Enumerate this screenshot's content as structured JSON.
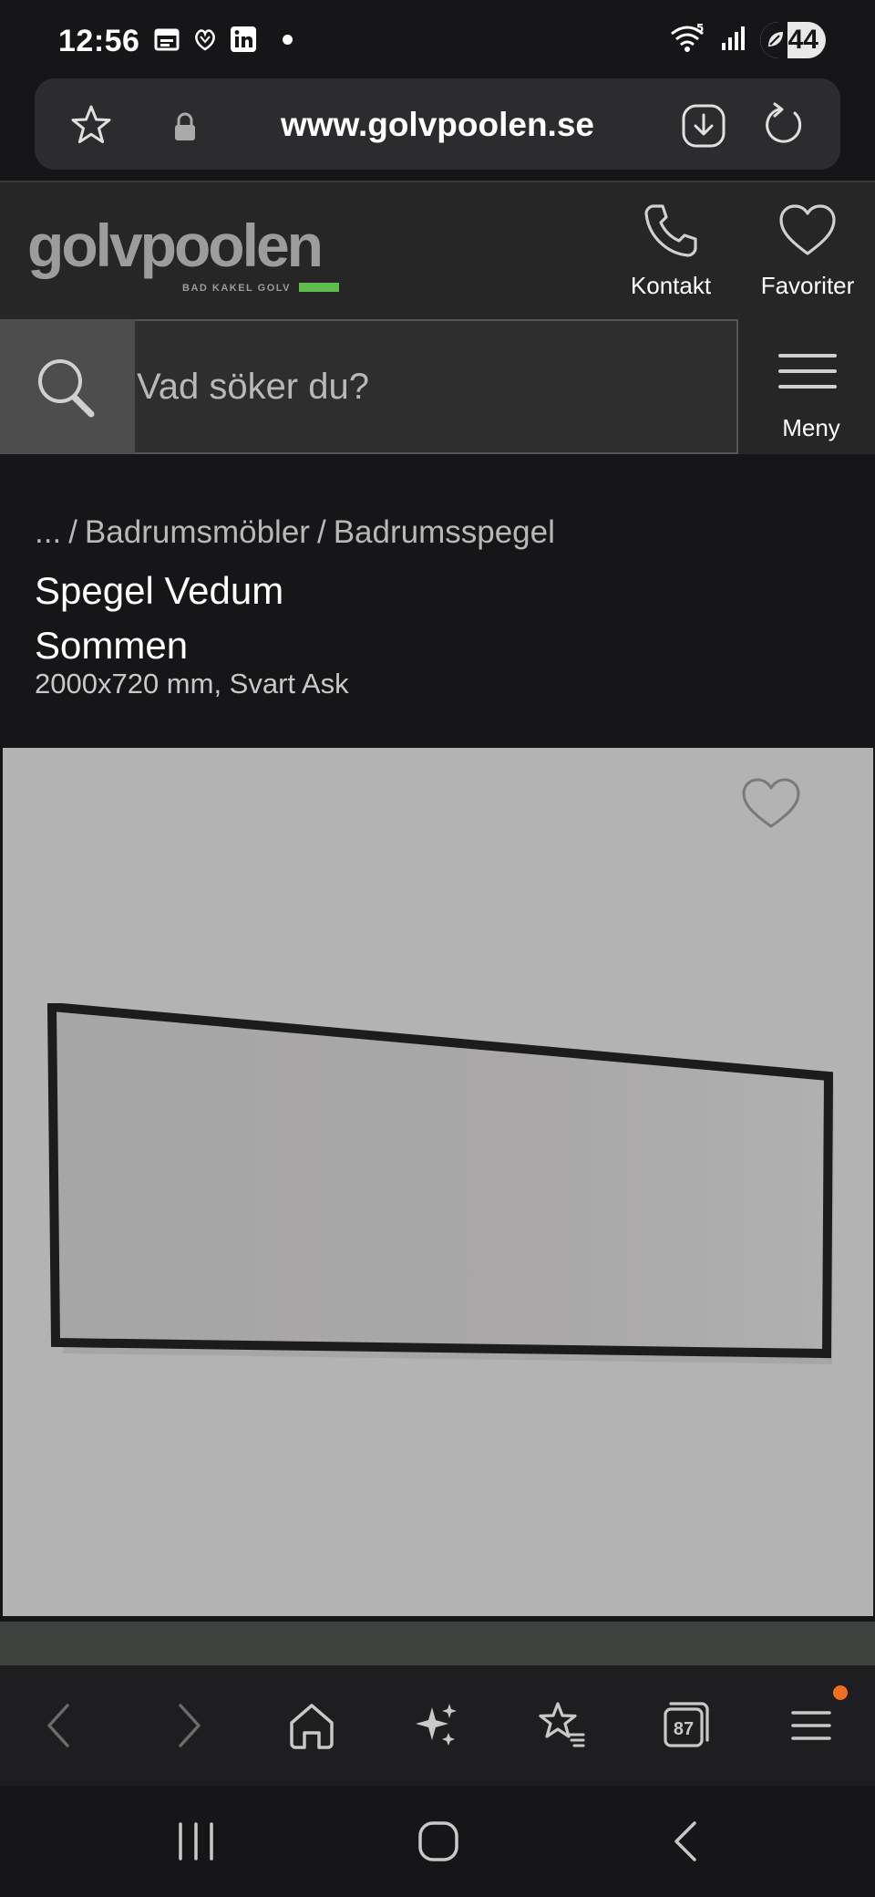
{
  "status_bar": {
    "time": "12:56",
    "battery": "44",
    "signal_label": "5"
  },
  "browser": {
    "url": "www.golvpoolen.se",
    "tab_count": "87"
  },
  "site": {
    "logo_text": "golvpoolen",
    "logo_tagline": "BAD KAKEL GOLV",
    "brand_color": "#5fbb4e",
    "contact_label": "Kontakt",
    "favorites_label": "Favoriter",
    "search_placeholder": "Vad söker du?",
    "menu_label": "Meny"
  },
  "breadcrumb": {
    "ellipsis": "...",
    "items": [
      "Badrumsmöbler",
      "Badrumsspegel"
    ]
  },
  "product": {
    "title_line1": "Spegel Vedum",
    "title_line2": "Sommen",
    "subtitle": "2000x720 mm, Svart Ask"
  }
}
